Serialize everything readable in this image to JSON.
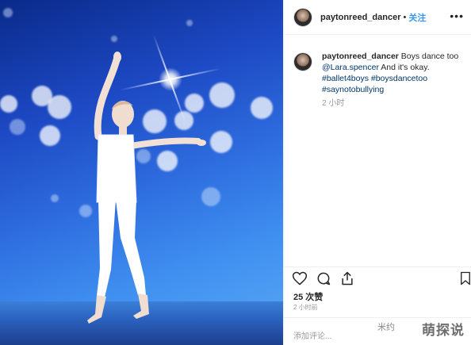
{
  "post": {
    "username": "paytonreed_dancer",
    "dot": "•",
    "follow_label": "关注",
    "more_label": "•••"
  },
  "caption": {
    "username": "paytonreed_dancer",
    "text_1": " Boys dance too ",
    "mention": "@Lara.spencer",
    "text_2": " And it's okay.",
    "hashtags_line1": "#ballet4boys #boysdancetoo",
    "hashtags_line2": "#saynotobullying",
    "time": "2 小时"
  },
  "actions": {
    "like_icon": "heart-icon",
    "comment_icon": "comment-icon",
    "share_icon": "share-icon",
    "save_icon": "bookmark-icon"
  },
  "likes": "25 次赞",
  "post_time": "2 小时前",
  "comment_placeholder": "添加评论...",
  "watermark": {
    "small": "米约",
    "big": "萌探说"
  }
}
